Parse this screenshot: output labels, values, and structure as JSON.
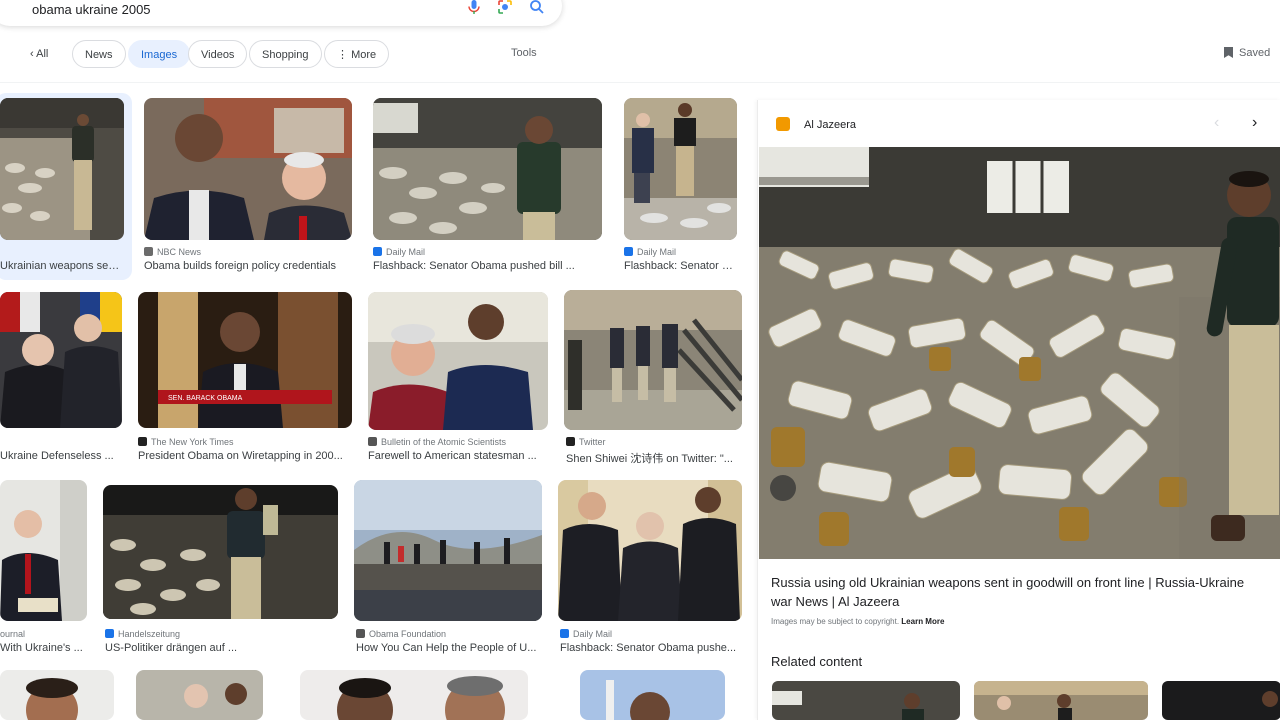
{
  "search": {
    "query": "obama ukraine 2005"
  },
  "filters": {
    "back_label": "All",
    "items": [
      "News",
      "Images",
      "Videos",
      "Shopping",
      "More"
    ],
    "active": "Images",
    "tools": "Tools"
  },
  "saved_label": "Saved",
  "results": [
    {
      "source": "",
      "caption": "Ukrainian weapons sent..."
    },
    {
      "source": "NBC News",
      "caption": "Obama builds foreign policy credentials"
    },
    {
      "source": "Daily Mail",
      "caption": "Flashback: Senator Obama pushed bill ..."
    },
    {
      "source": "Daily Mail",
      "caption": "Flashback: Senator O..."
    },
    {
      "source": "",
      "caption": "Ukraine Defenseless ..."
    },
    {
      "source": "The New York Times",
      "caption": "President Obama on Wiretapping in 200..."
    },
    {
      "source": "Bulletin of the Atomic Scientists",
      "caption": "Farewell to American statesman ..."
    },
    {
      "source": "Twitter",
      "caption": "Shen Shiwei 沈诗伟 on Twitter: \"..."
    },
    {
      "source": "ournal",
      "caption": "With Ukraine's ..."
    },
    {
      "source": "Handelszeitung",
      "caption": "US-Politiker drängen auf ..."
    },
    {
      "source": "Obama Foundation",
      "caption": "How You Can Help the People of U..."
    },
    {
      "source": "Daily Mail",
      "caption": "Flashback: Senator Obama pushe..."
    }
  ],
  "tile_overlay": "SEN. BARACK OBAMA",
  "panel": {
    "source": "Al Jazeera",
    "title": "Russia using old Ukrainian weapons sent in goodwill on front line | Russia-Ukraine war News | Al Jazeera",
    "copyright": "Images may be subject to copyright.",
    "learn_more": "Learn More",
    "related": "Related content"
  },
  "colors": {
    "accent": "#1967d2",
    "chip_active_bg": "#e8f0fe",
    "aljazeera": "#f29900"
  }
}
